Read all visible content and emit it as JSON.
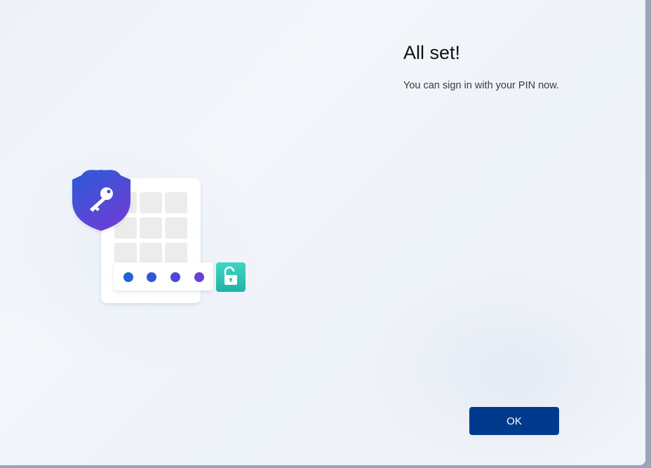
{
  "dialog": {
    "title": "All set!",
    "subtitle": "You can sign in with your PIN now.",
    "ok_label": "OK"
  },
  "illustration": {
    "icons": [
      "shield-key-icon",
      "pin-keypad",
      "unlock-icon"
    ],
    "pin_dots_count": 4
  },
  "colors": {
    "button": "#003a8c",
    "shield_top": "#2b5bd7",
    "shield_bottom": "#6a3fd6",
    "unlock": "#2ec4b6"
  }
}
